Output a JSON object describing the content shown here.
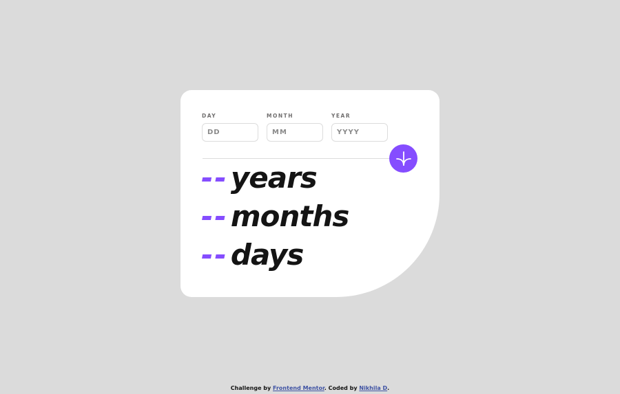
{
  "form": {
    "day": {
      "label": "DAY",
      "placeholder": "DD"
    },
    "month": {
      "label": "MONTH",
      "placeholder": "MM"
    },
    "year": {
      "label": "YEAR",
      "placeholder": "YYYY"
    },
    "submit_icon": "arrow-down-icon"
  },
  "results": {
    "years": {
      "value": "--",
      "unit": "years"
    },
    "months": {
      "value": "--",
      "unit": "months"
    },
    "days": {
      "value": "--",
      "unit": "days"
    }
  },
  "footer": {
    "prefix": "Challenge by",
    "link1": "Frontend Mentor",
    "middle": ". Coded by",
    "link2": "Nikhila D",
    "suffix": "."
  },
  "colors": {
    "accent": "#854dff",
    "background": "#dbdbdb",
    "card": "#ffffff"
  }
}
